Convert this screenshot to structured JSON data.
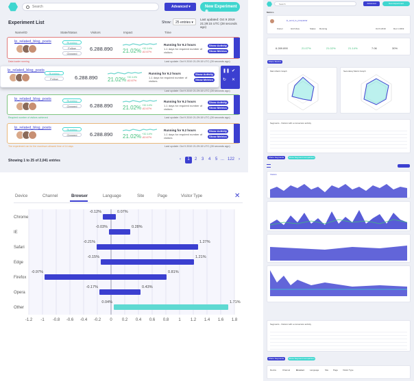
{
  "experiments": {
    "search_placeholder": "Search",
    "advanced_label": "Advanced",
    "new_experiment_label": "New Experiment",
    "title": "Experiment List",
    "show_label": "Show:",
    "show_value": "25 entries",
    "last_updated": "Last updated: Oct 9 2019 21:29:15 UTC (28 seconds ago)",
    "headers": [
      "Name/ID",
      "State/Status",
      "Visitors",
      "Impact",
      "Time"
    ],
    "rows": [
      {
        "name": "lp_related_blog_posts",
        "state_main": "Running",
        "state_a": "Follow",
        "state_b": "Cleaned",
        "visitors": "6.288.890",
        "impact": "21.02%",
        "pos": "+32.14%",
        "neg": "-62.67%",
        "running": "Running for 9.2 hours",
        "remaining": "1-1 days for required number of visitors",
        "show_activity": "Show Activity",
        "show_metrics": "Show Metrics",
        "updated": "Last update: Oct 9 2019 21:29:15 UTC (28 seconds ago)",
        "warning": "Data loader running"
      },
      {
        "name": "lp_related_blog_posts",
        "state_main": "Running",
        "state_a": "Follow",
        "state_b": "",
        "visitors": "6.288.890",
        "impact": "21.02%",
        "pos": "+32.14%",
        "neg": "-62.67%",
        "running": "Running for 9.2 hours",
        "remaining": "1-1 days for required number of visitors",
        "show_activity": "Show Activity",
        "show_metrics": "Show Metrics",
        "updated": "Last update: Oct 9 2019 21:29:15 UTC (28 seconds ago)",
        "warning": ""
      },
      {
        "name": "lp_related_blog_posts",
        "state_main": "Running",
        "state_a": "Cleaned",
        "state_b": "",
        "visitors": "6.288.890",
        "impact": "21.02%",
        "pos": "+32.14%",
        "neg": "-62.67%",
        "running": "Running for 9.2 hours",
        "remaining": "1-1 days for required number of visitors",
        "show_activity": "Show Activity",
        "show_metrics": "Show Metrics",
        "updated": "Last update: Oct 9 2019 21:29:15 UTC (28 seconds ago)",
        "warning": "Required number of visitors achieved"
      },
      {
        "name": "lp_related_blog_posts",
        "state_main": "Running",
        "state_a": "Cleaned",
        "state_b": "",
        "visitors": "6.288.890",
        "impact": "21.02%",
        "pos": "+32.14%",
        "neg": "-62.67%",
        "running": "Running for 9.2 hours",
        "remaining": "1-1 days for required number of visitors",
        "show_activity": "Show Activity",
        "show_metrics": "Show Metrics",
        "updated": "Last update: Oct 9 2019 21:29:15 UTC (28 seconds ago)",
        "warning": "The experiment ran for the maximum allowed time of 14 days"
      }
    ],
    "showing": "Showing 1 to 25 of 2,041 entries",
    "pages": [
      "1",
      "2",
      "3",
      "4",
      "5",
      "...",
      "122"
    ],
    "current_page": "1",
    "colors": {
      "accent": "#3b3fd0",
      "teal": "#3fd6cf",
      "positive": "#3fbe7a",
      "negative": "#e05050"
    }
  },
  "dashboard": {
    "search_placeholder": "Search",
    "advanced_label": "Advanced",
    "new_experiment_label": "New Experiment",
    "section_title": "Metrics",
    "experiment_name": "lp_send_to_prospektar",
    "header_chips": [
      "Owner",
      "Grid View",
      "Status",
      "Running"
    ],
    "date_chips": [
      "Oct 9 2019",
      "Dec 1 2019"
    ],
    "stats": [
      "6.289.890",
      "21.07%",
      "21.02%",
      "21.14%",
      "7.06",
      "30%"
    ],
    "filter_button": "Share Metrics",
    "radar_titles": [
      "Main Metric Graph",
      "Secondary Metric Graph"
    ],
    "tables": [
      {
        "title": "Segments - Visitors with a conversion activity"
      },
      {
        "title": "Segments - Visitors with a conversion activity"
      }
    ],
    "footer_buttons": [
      "Share Segments",
      "Show Segment Comparison"
    ],
    "chart_label": "Visitors",
    "footer_tabs": [
      "Device",
      "Channel",
      "Browser",
      "Language",
      "Site",
      "Page",
      "Visitor Type"
    ]
  },
  "browser_chart": {
    "tabs": [
      "Device",
      "Channel",
      "Browser",
      "Language",
      "Site",
      "Page",
      "Visitor Type"
    ],
    "active_tab": "Browser",
    "close_icon": "close-icon"
  },
  "chart_data": {
    "type": "bar",
    "orientation": "horizontal-range",
    "categories": [
      "Chrome",
      "IE",
      "Safari",
      "Edge",
      "Firefox",
      "Opera",
      "Other"
    ],
    "low": [
      -0.12,
      -0.03,
      -0.21,
      -0.15,
      -0.97,
      -0.17,
      0.04
    ],
    "high": [
      0.07,
      0.28,
      1.27,
      1.21,
      0.81,
      0.43,
      1.71
    ],
    "low_labels": [
      "-0.12%",
      "-0.03%",
      "-0.21%",
      "-0.15%",
      "-0.97%",
      "-0.17%",
      "0.04%"
    ],
    "high_labels": [
      "0.07%",
      "0.28%",
      "1.27%",
      "1.21%",
      "0.81%",
      "0.43%",
      "1.71%"
    ],
    "highlight_color": [
      "#3b3fd0",
      "#3b3fd0",
      "#3b3fd0",
      "#3b3fd0",
      "#3b3fd0",
      "#3b3fd0",
      "#5fd9d2"
    ],
    "xticks": [
      "-1.2",
      "-1",
      "-0.8",
      "-0.6",
      "-0.4",
      "-0.2",
      "0",
      "0.2",
      "0.4",
      "0.6",
      "0.8",
      "1",
      "1.2",
      "1.4",
      "1.6",
      "1.8"
    ],
    "xlim": [
      -1.2,
      1.8
    ],
    "title": "",
    "xlabel": "",
    "ylabel": ""
  }
}
